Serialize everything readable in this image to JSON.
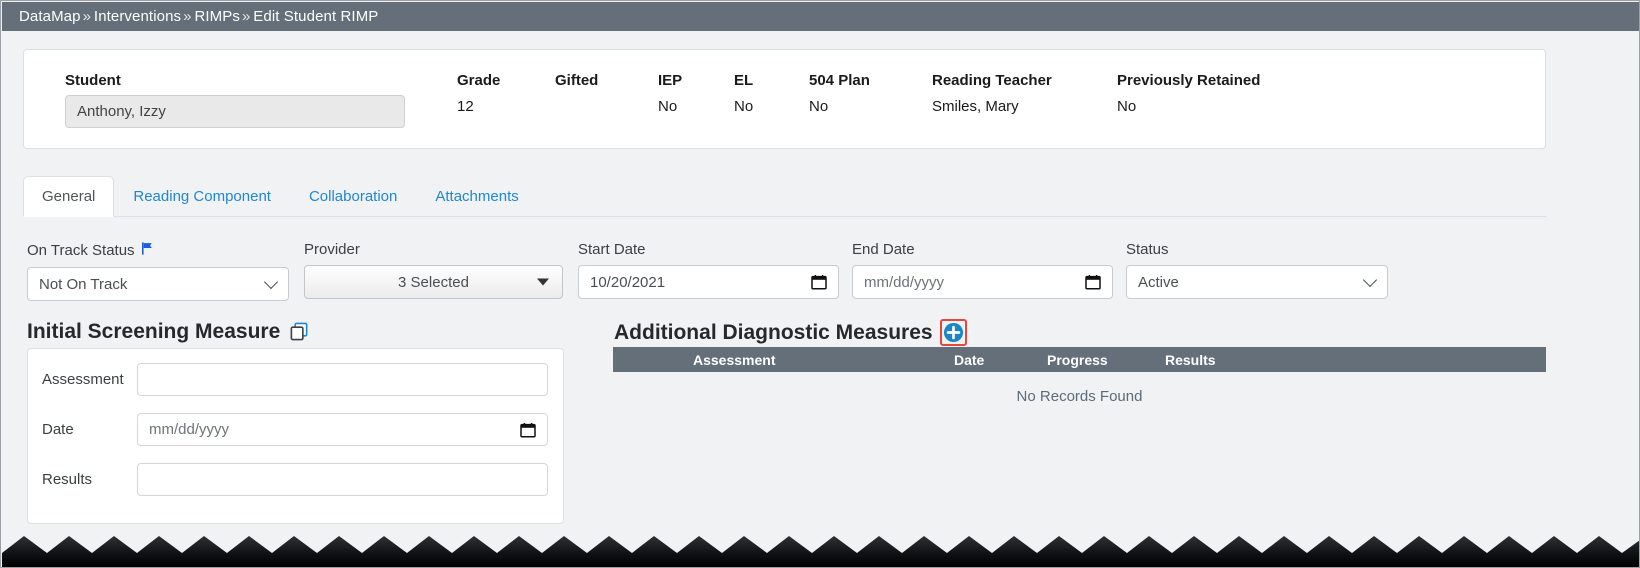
{
  "breadcrumb": {
    "items": [
      "DataMap",
      "Interventions",
      "RIMPs",
      "Edit Student RIMP"
    ],
    "separator": "»"
  },
  "student_card": {
    "fields": [
      {
        "label": "Student",
        "value": "Anthony, Izzy",
        "type": "input"
      },
      {
        "label": "Grade",
        "value": "12",
        "type": "text"
      },
      {
        "label": "Gifted",
        "value": "",
        "type": "text"
      },
      {
        "label": "IEP",
        "value": "No",
        "type": "text"
      },
      {
        "label": "EL",
        "value": "No",
        "type": "text"
      },
      {
        "label": "504 Plan",
        "value": "No",
        "type": "text"
      },
      {
        "label": "Reading Teacher",
        "value": "Smiles, Mary",
        "type": "text"
      },
      {
        "label": "Previously Retained",
        "value": "No",
        "type": "text"
      }
    ]
  },
  "tabs": [
    {
      "label": "General",
      "active": true
    },
    {
      "label": "Reading Component",
      "active": false
    },
    {
      "label": "Collaboration",
      "active": false
    },
    {
      "label": "Attachments",
      "active": false
    }
  ],
  "form": {
    "on_track_status": {
      "label": "On Track Status",
      "value": "Not On Track",
      "icon": "flag-icon"
    },
    "provider": {
      "label": "Provider",
      "value": "3 Selected"
    },
    "start_date": {
      "label": "Start Date",
      "value": "10/20/2021",
      "placeholder": "mm/dd/yyyy"
    },
    "end_date": {
      "label": "End Date",
      "value": "",
      "placeholder": "mm/dd/yyyy"
    },
    "status": {
      "label": "Status",
      "value": "Active"
    }
  },
  "initial_screening_measure": {
    "title": "Initial Screening Measure",
    "copy_icon": "copy-icon",
    "rows": [
      {
        "label": "Assessment",
        "value": "",
        "placeholder": ""
      },
      {
        "label": "Date",
        "value": "",
        "placeholder": "mm/dd/yyyy"
      },
      {
        "label": "Results",
        "value": "",
        "placeholder": ""
      }
    ]
  },
  "additional_diagnostic_measures": {
    "title": "Additional Diagnostic Measures",
    "add_icon": "plus-circle-icon",
    "columns": [
      "Assessment",
      "Date",
      "Progress",
      "Results"
    ],
    "rows": [],
    "empty_text": "No Records Found"
  },
  "colors": {
    "header_bar": "#646f7a",
    "page_bg": "#f1f2f4",
    "link": "#1f87d4",
    "table_header": "#646f7a",
    "highlight": "#e8453c",
    "add_button": "#1a86c8",
    "flag": "#1255cc"
  }
}
